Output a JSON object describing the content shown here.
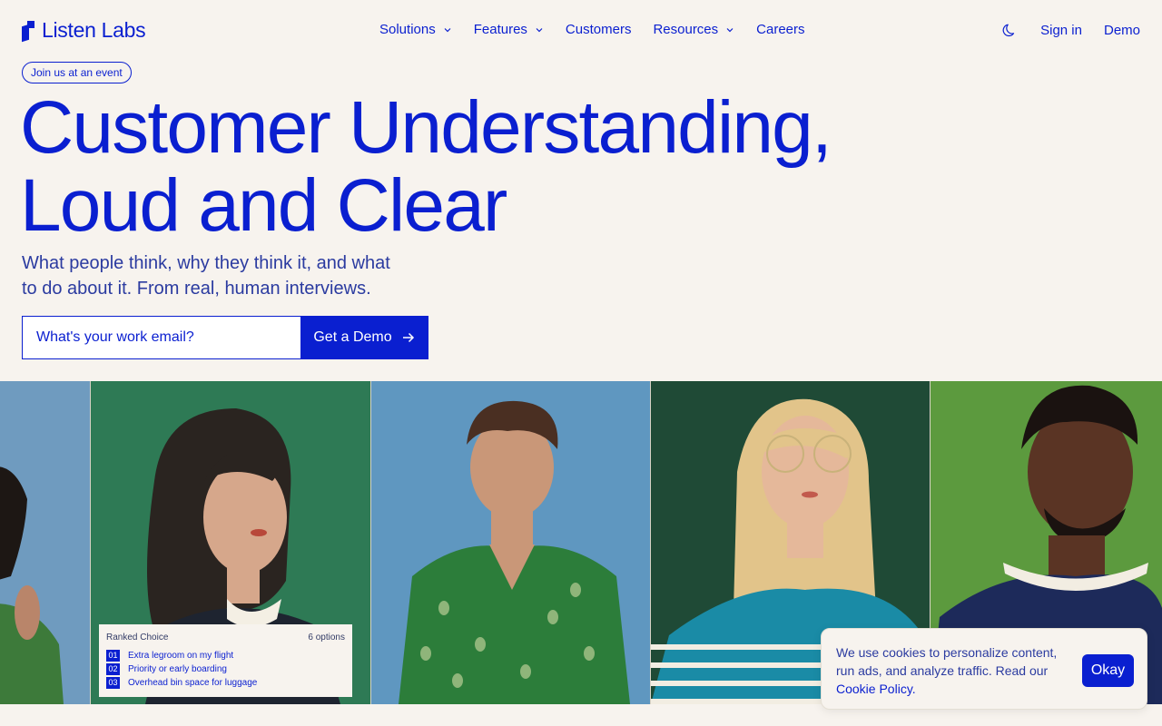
{
  "brand": {
    "name": "Listen Labs",
    "accent": "#0a1fd0",
    "background": "#f7f3ee"
  },
  "nav": {
    "links": [
      {
        "label": "Solutions",
        "dropdown": true
      },
      {
        "label": "Features",
        "dropdown": true
      },
      {
        "label": "Customers",
        "dropdown": false
      },
      {
        "label": "Resources",
        "dropdown": true
      },
      {
        "label": "Careers",
        "dropdown": false
      }
    ],
    "theme_icon": "moon-icon",
    "sign_in": "Sign in",
    "demo": "Demo"
  },
  "hero": {
    "event_pill": "Join us at an event",
    "headline_line1": "Customer Understanding,",
    "headline_line2": "Loud and Clear",
    "subhead_line1": "What people think, why they think it, and what",
    "subhead_line2": "to do about it. From real, human interviews.",
    "email_placeholder": "What's your work email?",
    "cta_label": "Get a Demo"
  },
  "photos": [
    {
      "subject": "person-portrait-partial",
      "bg": "#6f9bbf"
    },
    {
      "subject": "woman-portrait",
      "bg": "#2e7a55"
    },
    {
      "subject": "young-man-portrait",
      "bg": "#5f97c0"
    },
    {
      "subject": "woman-glasses-portrait",
      "bg": "#1f4a36"
    },
    {
      "subject": "man-portrait",
      "bg": "#5c9a3e"
    }
  ],
  "ranked_choice": {
    "title": "Ranked Choice",
    "count": "6 options",
    "items": [
      {
        "num": "01",
        "label": "Extra legroom on my flight"
      },
      {
        "num": "02",
        "label": "Priority or early boarding"
      },
      {
        "num": "03",
        "label": "Overhead bin space for luggage"
      }
    ]
  },
  "cookie": {
    "text": "We use cookies to personalize content, run ads, and analyze traffic. Read our",
    "link": "Cookie Policy.",
    "button": "Okay"
  }
}
